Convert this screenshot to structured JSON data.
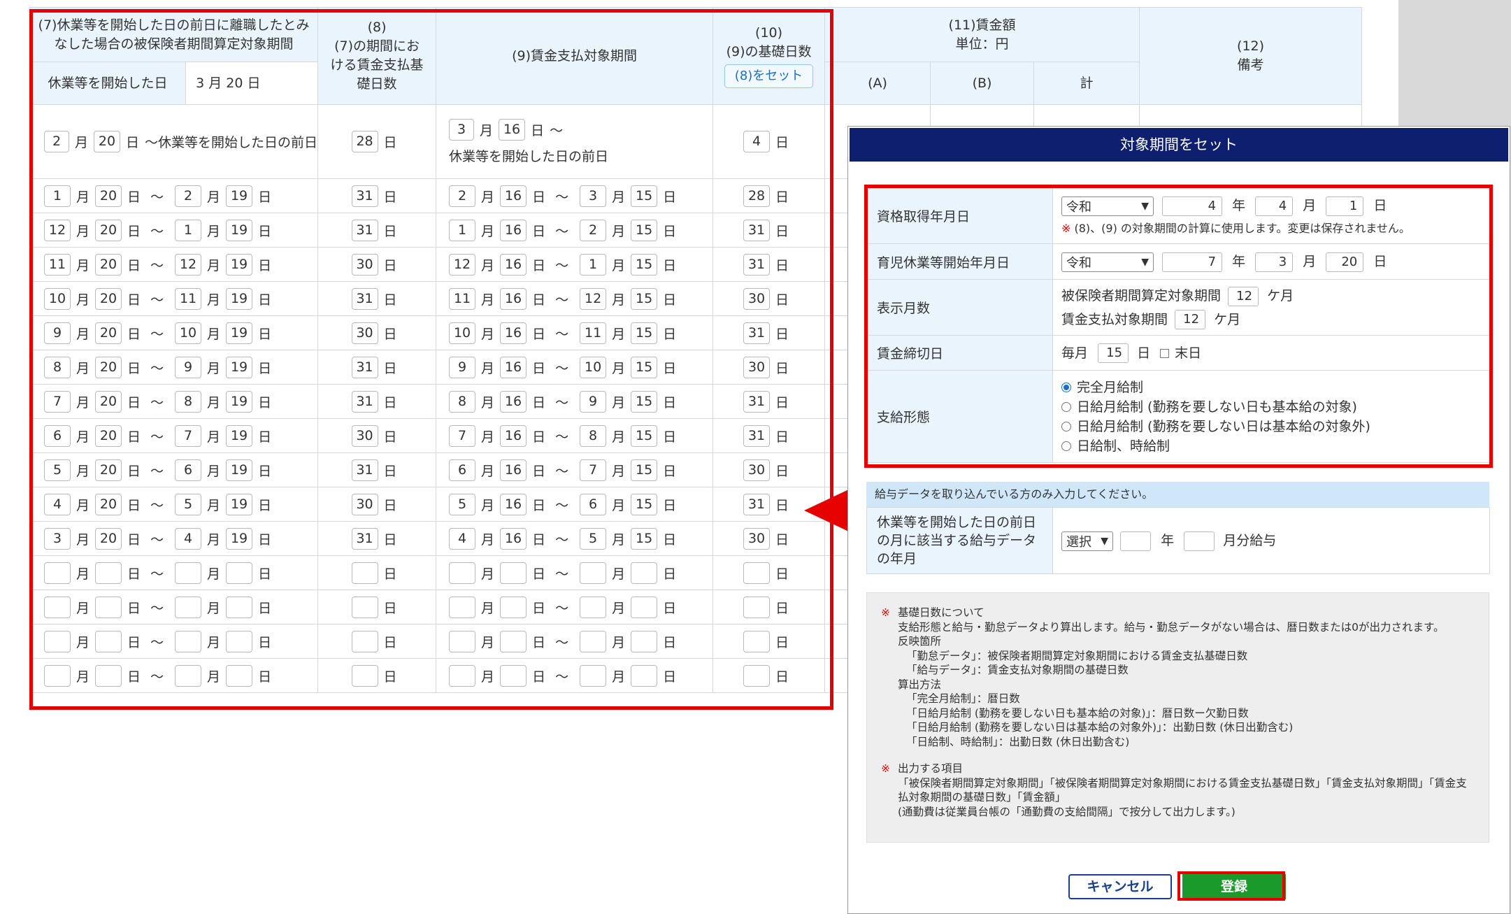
{
  "header": {
    "col7_title": "(7)休業等を開始した日の前日に離職したとみなした場合の被保険者期間算定対象期間",
    "col7_start_label": "休業等を開始した日",
    "col7_start_value": "3 月 20 日",
    "col8_title": "(8)\n(7)の期間における賃金支払基礎日数",
    "col9_title": "(9)賃金支払対象期間",
    "col10_title": "(10)\n(9)の基礎日数",
    "set_button": "(8)をセット",
    "col11_title": "(11)賃金額\n単位：円",
    "col11_a": "(A)",
    "col11_b": "(B)",
    "col11_total": "計",
    "col12_title": "(12)\n備考"
  },
  "units": {
    "month": "月",
    "day": "日",
    "tilde": "〜"
  },
  "first_row": {
    "c7_month": "2",
    "c7_day": "20",
    "c7_suffix": "〜休業等を開始した日の前日",
    "c8": "28",
    "c9_month": "3",
    "c9_day": "16",
    "c9_suffix": "休業等を開始した日の前日",
    "c10": "4"
  },
  "rows": [
    {
      "a": [
        "1",
        "20",
        "2",
        "19"
      ],
      "b": "31",
      "c": [
        "2",
        "16",
        "3",
        "15"
      ],
      "d": "28"
    },
    {
      "a": [
        "12",
        "20",
        "1",
        "19"
      ],
      "b": "31",
      "c": [
        "1",
        "16",
        "2",
        "15"
      ],
      "d": "31"
    },
    {
      "a": [
        "11",
        "20",
        "12",
        "19"
      ],
      "b": "30",
      "c": [
        "12",
        "16",
        "1",
        "15"
      ],
      "d": "31"
    },
    {
      "a": [
        "10",
        "20",
        "11",
        "19"
      ],
      "b": "31",
      "c": [
        "11",
        "16",
        "12",
        "15"
      ],
      "d": "30"
    },
    {
      "a": [
        "9",
        "20",
        "10",
        "19"
      ],
      "b": "30",
      "c": [
        "10",
        "16",
        "11",
        "15"
      ],
      "d": "31"
    },
    {
      "a": [
        "8",
        "20",
        "9",
        "19"
      ],
      "b": "31",
      "c": [
        "9",
        "16",
        "10",
        "15"
      ],
      "d": "30"
    },
    {
      "a": [
        "7",
        "20",
        "8",
        "19"
      ],
      "b": "31",
      "c": [
        "8",
        "16",
        "9",
        "15"
      ],
      "d": "31"
    },
    {
      "a": [
        "6",
        "20",
        "7",
        "19"
      ],
      "b": "30",
      "c": [
        "7",
        "16",
        "8",
        "15"
      ],
      "d": "31"
    },
    {
      "a": [
        "5",
        "20",
        "6",
        "19"
      ],
      "b": "31",
      "c": [
        "6",
        "16",
        "7",
        "15"
      ],
      "d": "30"
    },
    {
      "a": [
        "4",
        "20",
        "5",
        "19"
      ],
      "b": "30",
      "c": [
        "5",
        "16",
        "6",
        "15"
      ],
      "d": "31"
    },
    {
      "a": [
        "3",
        "20",
        "4",
        "19"
      ],
      "b": "31",
      "c": [
        "4",
        "16",
        "5",
        "15"
      ],
      "d": "30"
    },
    {
      "a": [
        "",
        "",
        "",
        ""
      ],
      "b": "",
      "c": [
        "",
        "",
        "",
        ""
      ],
      "d": ""
    },
    {
      "a": [
        "",
        "",
        "",
        ""
      ],
      "b": "",
      "c": [
        "",
        "",
        "",
        ""
      ],
      "d": ""
    },
    {
      "a": [
        "",
        "",
        "",
        ""
      ],
      "b": "",
      "c": [
        "",
        "",
        "",
        ""
      ],
      "d": ""
    },
    {
      "a": [
        "",
        "",
        "",
        ""
      ],
      "b": "",
      "c": [
        "",
        "",
        "",
        ""
      ],
      "d": ""
    }
  ],
  "modal": {
    "title": "対象期間をセット",
    "acq_label": "資格取得年月日",
    "acq_era": "令和",
    "acq_year": "4",
    "acq_month": "4",
    "acq_day": "1",
    "year_unit": "年",
    "month_unit": "月",
    "day_unit": "日",
    "acq_note_mark": "※",
    "acq_note": "(8)、(9) の対象期間の計算に使用します。変更は保存されません。",
    "leave_label": "育児休業等開始年月日",
    "leave_era": "令和",
    "leave_year": "7",
    "leave_month": "3",
    "leave_day": "20",
    "months_label": "表示月数",
    "months_insured_label": "被保険者期間算定対象期間",
    "months_insured_value": "12",
    "months_wage_label": "賃金支払対象期間",
    "months_wage_value": "12",
    "months_unit": "ケ月",
    "cutoff_label": "賃金締切日",
    "cutoff_prefix": "毎月",
    "cutoff_value": "15",
    "cutoff_day_unit": "日",
    "cutoff_eom": "末日",
    "paytype_label": "支給形態",
    "paytype_options": [
      "完全月給制",
      "日給月給制 (勤務を要しない日も基本給の対象)",
      "日給月給制 (勤務を要しない日は基本給の対象外)",
      "日給制、時給制"
    ],
    "paytype_selected": "完全月給制",
    "pay_note": "給与データを取り込んでいる方のみ入力してください。",
    "pay_label": "休業等を開始した日の前日の月に該当する給与データの年月",
    "pay_select": "選択",
    "pay_year_unit": "年",
    "pay_month_unit": "月分給与",
    "info_mark": "※",
    "info1_title": "基礎日数について",
    "info1_lines": [
      "支給形態と給与・勤怠データより算出します。給与・勤怠データがない場合は、暦日数または0が出力されます。",
      "反映箇所",
      "「勤怠データ」：被保険者期間算定対象期間における賃金支払基礎日数",
      "「給与データ」：賃金支払対象期間の基礎日数",
      "算出方法",
      "「完全月給制」：暦日数",
      "「日給月給制 (勤務を要しない日も基本給の対象)」：暦日数ー欠勤日数",
      "「日給月給制 (勤務を要しない日は基本給の対象外)」：出勤日数 (休日出勤含む)",
      "「日給制、時給制」：出勤日数 (休日出勤含む)"
    ],
    "info2_title": "出力する項目",
    "info2_lines": [
      "「被保険者期間算定対象期間」「被保険者期間算定対象期間における賃金支払基礎日数」「賃金支払対象期間」「賃金支払対象期間の基礎日数」「賃金額」",
      "(通勤費は従業員台帳の「通勤費の支給間隔」で按分して出力します。)"
    ],
    "cancel": "キャンセル",
    "register": "登録"
  },
  "colors": {
    "header_bg": "#eaf4fc",
    "modal_header": "#0d1f6e",
    "annotation": "#e60000",
    "register": "#1a9a2a",
    "cancel_border": "#1a3f8f"
  }
}
